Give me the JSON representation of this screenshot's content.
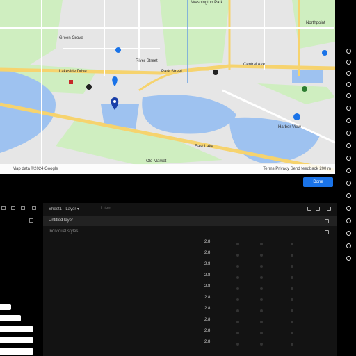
{
  "map": {
    "labels": [
      {
        "text": "Washington Park"
      },
      {
        "text": "Green Grove"
      },
      {
        "text": "Lakeside Drive"
      },
      {
        "text": "River Street"
      },
      {
        "text": "Park Street"
      },
      {
        "text": "Central Ave"
      },
      {
        "text": "Harbor View"
      },
      {
        "text": "East Lake"
      },
      {
        "text": "Northpoint"
      },
      {
        "text": "Old Market"
      }
    ],
    "footer_left": "Map data ©2024 Google",
    "footer_right": "Terms  Privacy  Send feedback  200 m"
  },
  "done_label": "Done",
  "panel": {
    "header": "Sheet1 · Layer ▾",
    "header_secondary": "1 item",
    "row1": "Untitled layer",
    "row2": "Individual styles",
    "values": [
      "2.8",
      "2.8",
      "2.8",
      "2.8",
      "2.8",
      "2.8",
      "2.8",
      "2.8",
      "2.8",
      "2.8"
    ]
  },
  "colors": {
    "water": "#9ec2f0",
    "park": "#cfeec0",
    "road": "#f6d36e",
    "accent": "#1a73e8"
  }
}
